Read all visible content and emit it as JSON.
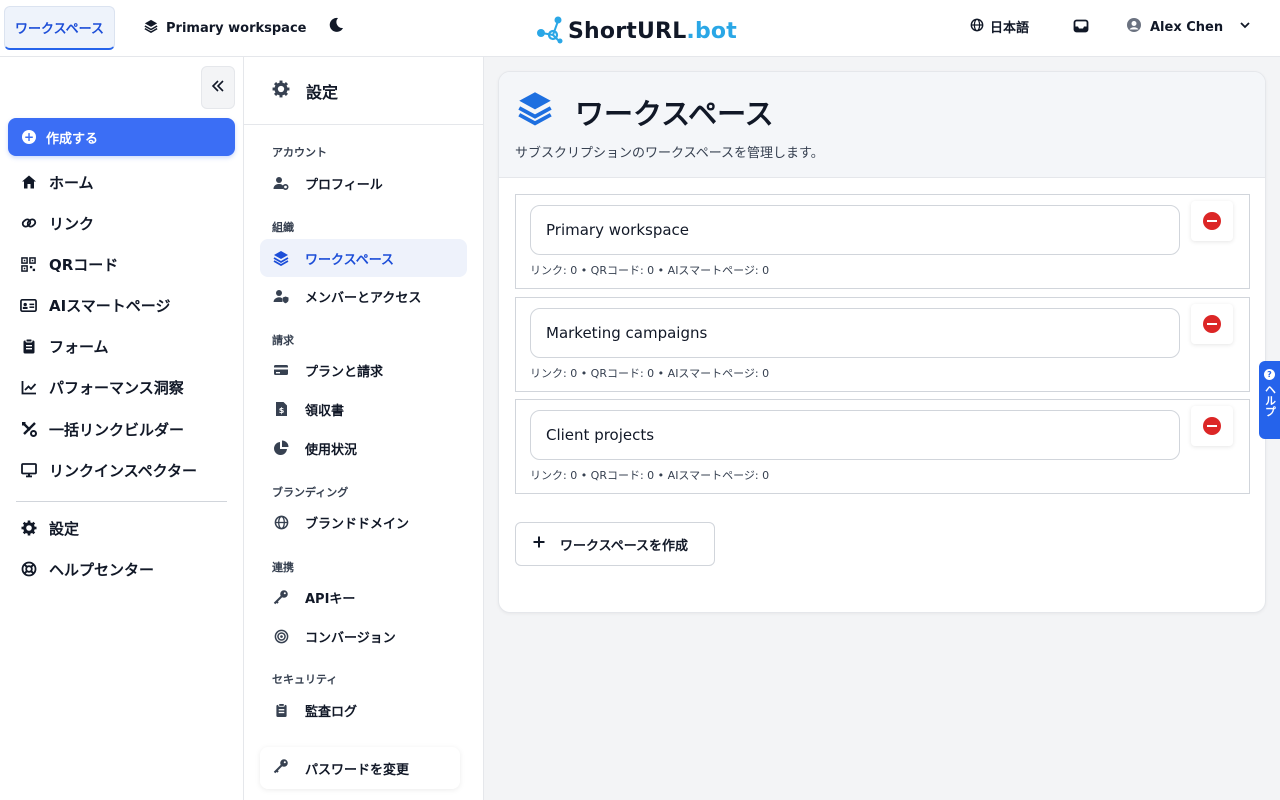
{
  "topbar": {
    "workspace_tab": "ワークスペース",
    "workspace_select": "Primary workspace",
    "brand": {
      "prefix": "ShortURL",
      "suffix": ".bot"
    },
    "language": "日本語",
    "user_name": "Alex Chen"
  },
  "leftnav": {
    "create": "作成する",
    "items": [
      {
        "label": "ホーム",
        "icon": "home-icon"
      },
      {
        "label": "リンク",
        "icon": "link-icon"
      },
      {
        "label": "QRコード",
        "icon": "qr-icon"
      },
      {
        "label": "AIスマートページ",
        "icon": "id-card-icon"
      },
      {
        "label": "フォーム",
        "icon": "clipboard-icon"
      },
      {
        "label": "パフォーマンス洞察",
        "icon": "chart-icon"
      },
      {
        "label": "一括リンクビルダー",
        "icon": "tools-icon"
      },
      {
        "label": "リンクインスペクター",
        "icon": "monitor-icon"
      }
    ],
    "bottom": [
      {
        "label": "設定",
        "icon": "gear-icon"
      },
      {
        "label": "ヘルプセンター",
        "icon": "lifebuoy-icon"
      }
    ]
  },
  "settings": {
    "title": "設定",
    "sections": {
      "account": "アカウント",
      "org": "組織",
      "billing": "請求",
      "branding": "ブランディング",
      "integrations": "連携",
      "security": "セキュリティ"
    },
    "items": {
      "profile": "プロフィール",
      "workspaces": "ワークスペース",
      "members": "メンバーとアクセス",
      "plans": "プランと請求",
      "receipts": "領収書",
      "usage": "使用状況",
      "domains": "ブランドドメイン",
      "api": "APIキー",
      "conversions": "コンバージョン",
      "audit": "監査ログ"
    },
    "change_password": "パスワードを変更"
  },
  "main": {
    "title": "ワークスペース",
    "subtitle": "サブスクリプションのワークスペースを管理します。",
    "workspaces": [
      {
        "name": "Primary workspace",
        "meta": "リンク: 0 • QRコード: 0 • AIスマートページ: 0"
      },
      {
        "name": "Marketing campaigns",
        "meta": "リンク: 0 • QRコード: 0 • AIスマートページ: 0"
      },
      {
        "name": "Client projects",
        "meta": "リンク: 0 • QRコード: 0 • AIスマートページ: 0"
      }
    ],
    "create_button": "ワークスペースを作成"
  },
  "help_tab": "ヘルプ",
  "colors": {
    "accent": "#3b6ef5",
    "brand_suffix": "#2aa7e6",
    "danger": "#dc2626"
  }
}
